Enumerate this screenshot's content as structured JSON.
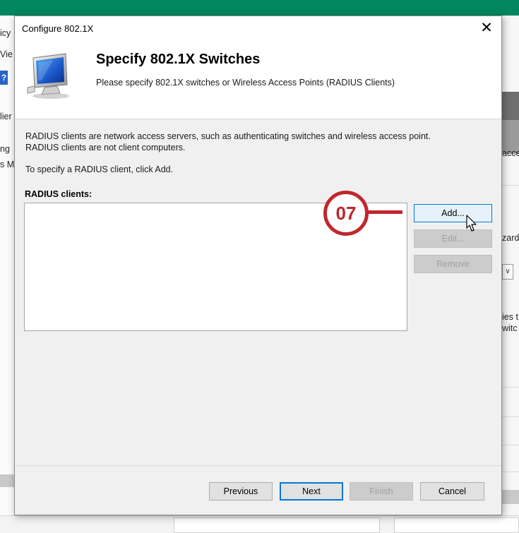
{
  "background": {
    "left_fragments": [
      "icy",
      "Vie",
      "?",
      "lier",
      "ng",
      "s M"
    ],
    "right_fragments": [
      "acce",
      "zard",
      "ies t",
      "witc"
    ],
    "dropdown_glyph": "∨"
  },
  "dialog": {
    "title": "Configure 802.1X",
    "close_glyph": "✕",
    "header": {
      "title": "Specify 802.1X Switches",
      "subtitle": "Please specify 802.1X switches or Wireless Access Points (RADIUS Clients)",
      "icon": "computer-monitor-icon"
    },
    "description_line1": "RADIUS clients are network access servers, such as authenticating switches and wireless access point.",
    "description_line2": "RADIUS clients are not client computers.",
    "instruction": "To specify a RADIUS client, click Add.",
    "clients_label": "RADIUS clients:",
    "clients": [],
    "buttons": {
      "add": "Add...",
      "edit": "Edit...",
      "remove": "Remove",
      "previous": "Previous",
      "next": "Next",
      "finish": "Finish",
      "cancel": "Cancel"
    }
  },
  "annotation": {
    "step": "07",
    "color": "#c0272d"
  },
  "colors": {
    "topbar": "#00875f",
    "focus": "#0078d7"
  }
}
